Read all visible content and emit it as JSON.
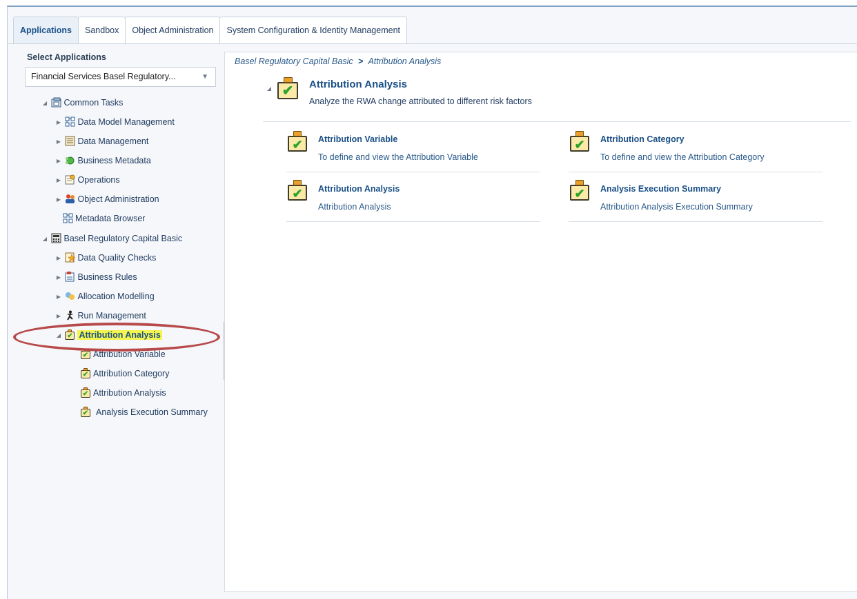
{
  "tabs": [
    {
      "label": "Applications",
      "active": true
    },
    {
      "label": "Sandbox"
    },
    {
      "label": "Object Administration"
    },
    {
      "label": "System Configuration & Identity Management"
    }
  ],
  "left": {
    "select_label": "Select Applications",
    "dropdown_value": "Financial Services Basel Regulatory...",
    "tree": {
      "common_tasks": "Common Tasks",
      "data_model_mgmt": "Data Model Management",
      "data_mgmt": "Data Management",
      "business_metadata": "Business Metadata",
      "operations": "Operations",
      "object_admin": "Object Administration",
      "metadata_browser": "Metadata Browser",
      "basel": "Basel Regulatory Capital Basic",
      "dq_checks": "Data Quality Checks",
      "business_rules": "Business Rules",
      "allocation": "Allocation Modelling",
      "run_mgmt": "Run Management",
      "attribution_analysis": "Attribution Analysis",
      "attr_variable": "Attribution Variable",
      "attr_category": "Attribution Category",
      "attr_analysis": "Attribution Analysis",
      "exec_summary": "Analysis Execution Summary"
    }
  },
  "right": {
    "breadcrumb": {
      "parent": "Basel Regulatory Capital Basic",
      "separator": ">",
      "current": "Attribution Analysis"
    },
    "header": {
      "title": "Attribution Analysis",
      "description": "Analyze the RWA change attributed to different risk factors"
    },
    "cards": [
      {
        "title": "Attribution Variable",
        "desc": "To define and view the Attribution Variable"
      },
      {
        "title": "Attribution Category",
        "desc": "To define and view the Attribution Category"
      },
      {
        "title": "Attribution Analysis",
        "desc": "Attribution Analysis"
      },
      {
        "title": "Analysis Execution Summary",
        "desc": "Attribution Analysis Execution Summary"
      }
    ]
  }
}
